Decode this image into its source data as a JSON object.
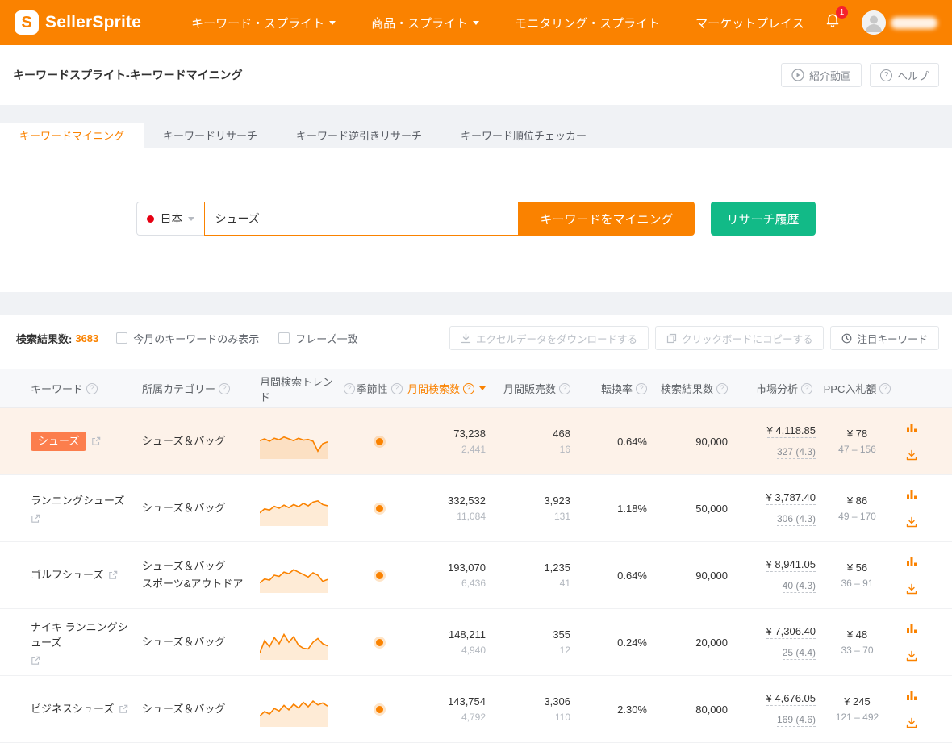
{
  "brand": {
    "name": "SellerSprite",
    "logo_letter": "S"
  },
  "nav": {
    "items": [
      {
        "label": "キーワード・スプライト",
        "dropdown": true
      },
      {
        "label": "商品・スプライト",
        "dropdown": true
      },
      {
        "label": "モニタリング・スプライト",
        "dropdown": false
      },
      {
        "label": "マーケットプレイス",
        "dropdown": false
      }
    ],
    "notification_count": "1"
  },
  "breadcrumb": {
    "title": "キーワードスプライト-キーワードマイニング"
  },
  "header_actions": {
    "intro_video": "紹介動画",
    "help": "ヘルプ"
  },
  "tabs": [
    {
      "label": "キーワードマイニング",
      "active": true
    },
    {
      "label": "キーワードリサーチ",
      "active": false
    },
    {
      "label": "キーワード逆引きリサーチ",
      "active": false
    },
    {
      "label": "キーワード順位チェッカー",
      "active": false
    }
  ],
  "search": {
    "country": "日本",
    "keyword": "シューズ",
    "mine_button": "キーワードをマイニング",
    "history_button": "リサーチ履歴"
  },
  "results_bar": {
    "count_label": "検索結果数:",
    "count": "3683",
    "filters": [
      {
        "label": "今月のキーワードのみ表示",
        "checked": false
      },
      {
        "label": "フレーズ一致",
        "checked": false
      }
    ],
    "buttons": {
      "excel": "エクセルデータをダウンロードする",
      "copy": "クリックボードにコピーする",
      "featured": "注目キーワード"
    }
  },
  "table": {
    "columns": [
      "キーワード",
      "所属カテゴリー",
      "月間検索トレンド",
      "季節性",
      "月間検索数",
      "月間販売数",
      "転換率",
      "検索結果数",
      "市場分析",
      "PPC入札額"
    ],
    "rows": [
      {
        "keyword": "シューズ",
        "badge": true,
        "highlight": true,
        "categories": [
          "シューズ＆バッグ"
        ],
        "trend": [
          52,
          58,
          50,
          60,
          55,
          64,
          58,
          52,
          60,
          54,
          56,
          50,
          18,
          42,
          48
        ],
        "search_volume": "73,238",
        "search_volume_sub": "2,441",
        "sales": "468",
        "sales_sub": "16",
        "conversion": "0.64%",
        "results": "90,000",
        "market_value": "¥ 4,118.85",
        "market_sub": "327 (4.3)",
        "ppc": "¥ 78",
        "ppc_range": "47 – 156"
      },
      {
        "keyword": "ランニングシューズ",
        "badge": false,
        "highlight": false,
        "categories": [
          "シューズ＆バッグ"
        ],
        "trend": [
          35,
          48,
          44,
          56,
          50,
          60,
          52,
          62,
          55,
          66,
          58,
          70,
          74,
          62,
          58
        ],
        "search_volume": "332,532",
        "search_volume_sub": "11,084",
        "sales": "3,923",
        "sales_sub": "131",
        "conversion": "1.18%",
        "results": "50,000",
        "market_value": "¥ 3,787.40",
        "market_sub": "306 (4.3)",
        "ppc": "¥ 86",
        "ppc_range": "49 – 170"
      },
      {
        "keyword": "ゴルフシューズ",
        "badge": false,
        "highlight": false,
        "categories": [
          "シューズ＆バッグ",
          "スポーツ&アウトドア"
        ],
        "trend": [
          25,
          38,
          34,
          50,
          46,
          60,
          55,
          68,
          60,
          52,
          44,
          58,
          50,
          30,
          36
        ],
        "search_volume": "193,070",
        "search_volume_sub": "6,436",
        "sales": "1,235",
        "sales_sub": "41",
        "conversion": "0.64%",
        "results": "90,000",
        "market_value": "¥ 8,941.05",
        "market_sub": "40 (4.3)",
        "ppc": "¥ 56",
        "ppc_range": "36 – 91"
      },
      {
        "keyword": "ナイキ ランニングシューズ",
        "badge": false,
        "highlight": false,
        "categories": [
          "シューズ＆バッグ"
        ],
        "trend": [
          15,
          55,
          35,
          65,
          45,
          75,
          50,
          68,
          40,
          30,
          28,
          50,
          62,
          45,
          38
        ],
        "search_volume": "148,211",
        "search_volume_sub": "4,940",
        "sales": "355",
        "sales_sub": "12",
        "conversion": "0.24%",
        "results": "20,000",
        "market_value": "¥ 7,306.40",
        "market_sub": "25 (4.4)",
        "ppc": "¥ 48",
        "ppc_range": "33 – 70"
      },
      {
        "keyword": "ビジネスシューズ",
        "badge": false,
        "highlight": false,
        "categories": [
          "シューズ＆バッグ"
        ],
        "trend": [
          28,
          42,
          34,
          52,
          44,
          62,
          48,
          66,
          54,
          72,
          58,
          76,
          64,
          70,
          60
        ],
        "search_volume": "143,754",
        "search_volume_sub": "4,792",
        "sales": "3,306",
        "sales_sub": "110",
        "conversion": "2.30%",
        "results": "80,000",
        "market_value": "¥ 4,676.05",
        "market_sub": "169 (4.6)",
        "ppc": "¥ 245",
        "ppc_range": "121 – 492"
      }
    ]
  }
}
